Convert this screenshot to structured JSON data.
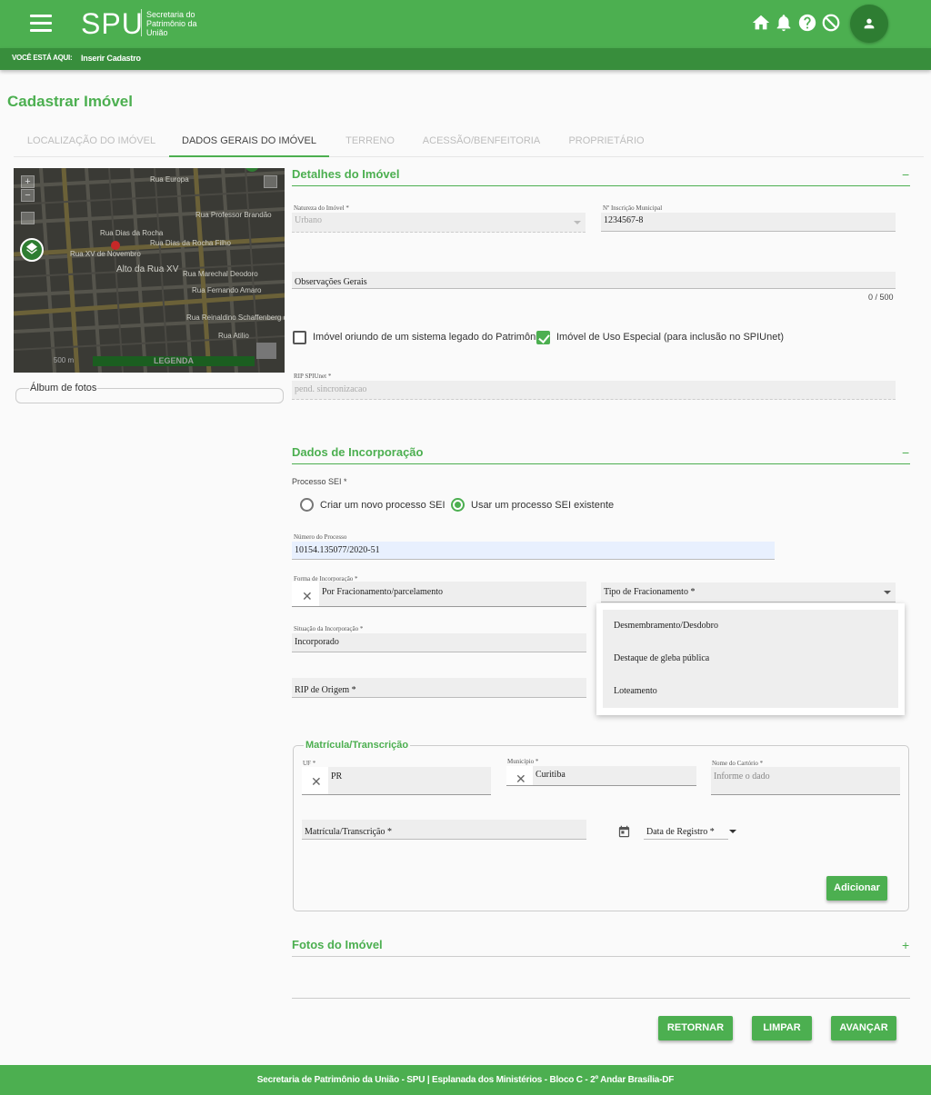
{
  "header": {
    "logo": "SPU",
    "logo_subtitle": "Secretaria do Patrimônio da União",
    "icons": [
      "home-icon",
      "bell-icon",
      "help-icon",
      "block-icon",
      "account-icon"
    ]
  },
  "breadcrumb": {
    "label": "VOCÊ ESTÁ AQUI:",
    "current": "Inserir Cadastro"
  },
  "page_title": "Cadastrar Imóvel",
  "tabs": [
    {
      "label": "LOCALIZAÇÃO DO IMÓVEL",
      "active": false
    },
    {
      "label": "DADOS GERAIS DO IMÓVEL",
      "active": true
    },
    {
      "label": "TERRENO",
      "active": false
    },
    {
      "label": "ACESSÃO/BENFEITORIA",
      "active": false
    },
    {
      "label": "PROPRIETÁRIO",
      "active": false
    }
  ],
  "map": {
    "zoom_in": "+",
    "zoom_out": "−",
    "scale": "500 m",
    "legend": "LEGENDA",
    "streets": [
      "Rua Europa",
      "Rua Professor Brandão",
      "Rua Dias da Rocha Filho",
      "Rua XV de Novembro",
      "Alto da Rua XV",
      "Rua Marechal Deodoro",
      "Rua Fernando Amaro",
      "Rua Reinaldino Schaffenberg de",
      "Rua Dias da Rocha",
      "Rua Atilio"
    ]
  },
  "album": {
    "label": "Álbum de fotos"
  },
  "detalhes": {
    "title": "Detalhes do Imóvel",
    "collapse": "−",
    "natureza_label": "Natureza do Imóvel *",
    "natureza_value": "Urbano",
    "inscricao_label": "Nº Inscrição Municipal",
    "inscricao_value": "1234567-8",
    "observacoes_label": "Observações Gerais",
    "observacoes_counter": "0 / 500",
    "legado_label": "Imóvel oriundo de um sistema legado do Patrimônio",
    "legado_checked": false,
    "uso_especial_label": "Imóvel de Uso Especial (para inclusão no SPIUnet)",
    "uso_especial_checked": true,
    "rip_label": "RIP SPIUnet *",
    "rip_value": "pend. sincronizacao"
  },
  "incorporacao": {
    "title": "Dados de Incorporação",
    "collapse": "−",
    "processo_label": "Processo SEI *",
    "radio_novo": "Criar um novo processo SEI",
    "radio_existente": "Usar um processo SEI existente",
    "selected": "existente",
    "numero_label": "Número do Processo",
    "numero_value": "10154.135077/2020-51",
    "forma_label": "Forma de Incorporação *",
    "forma_value": "Por Fracionamento/parcelamento",
    "tipo_label": "Tipo de Fracionamento *",
    "tipo_options": [
      "Desmembramento/Desdobro",
      "Destaque de gleba pública",
      "Loteamento"
    ],
    "situacao_label": "Situação da Incorporação *",
    "situacao_value": "Incorporado",
    "rip_origem_label": "RIP de Origem *"
  },
  "matricula": {
    "title": "Matrícula/Transcrição",
    "uf_label": "UF *",
    "uf_value": "PR",
    "municipio_label": "Município *",
    "municipio_value": "Curitiba",
    "cartorio_label": "Nome do Cartório *",
    "cartorio_placeholder": "Informe o dado",
    "matricula_label": "Matrícula/Transcrição *",
    "data_label": "Data de Registro *",
    "add_button": "Adicionar"
  },
  "fotos": {
    "title": "Fotos do Imóvel",
    "expand": "+"
  },
  "actions": {
    "retornar": "RETORNAR",
    "limpar": "LIMPAR",
    "avancar": "AVANÇAR"
  },
  "footer": "Secretaria de Patrimônio da União - SPU | Esplanada dos Ministérios - Bloco C - 2º Andar Brasília-DF",
  "colors": {
    "primary": "#4caf50",
    "primary_dark": "#388e3c",
    "avatar": "#2e7d32"
  }
}
